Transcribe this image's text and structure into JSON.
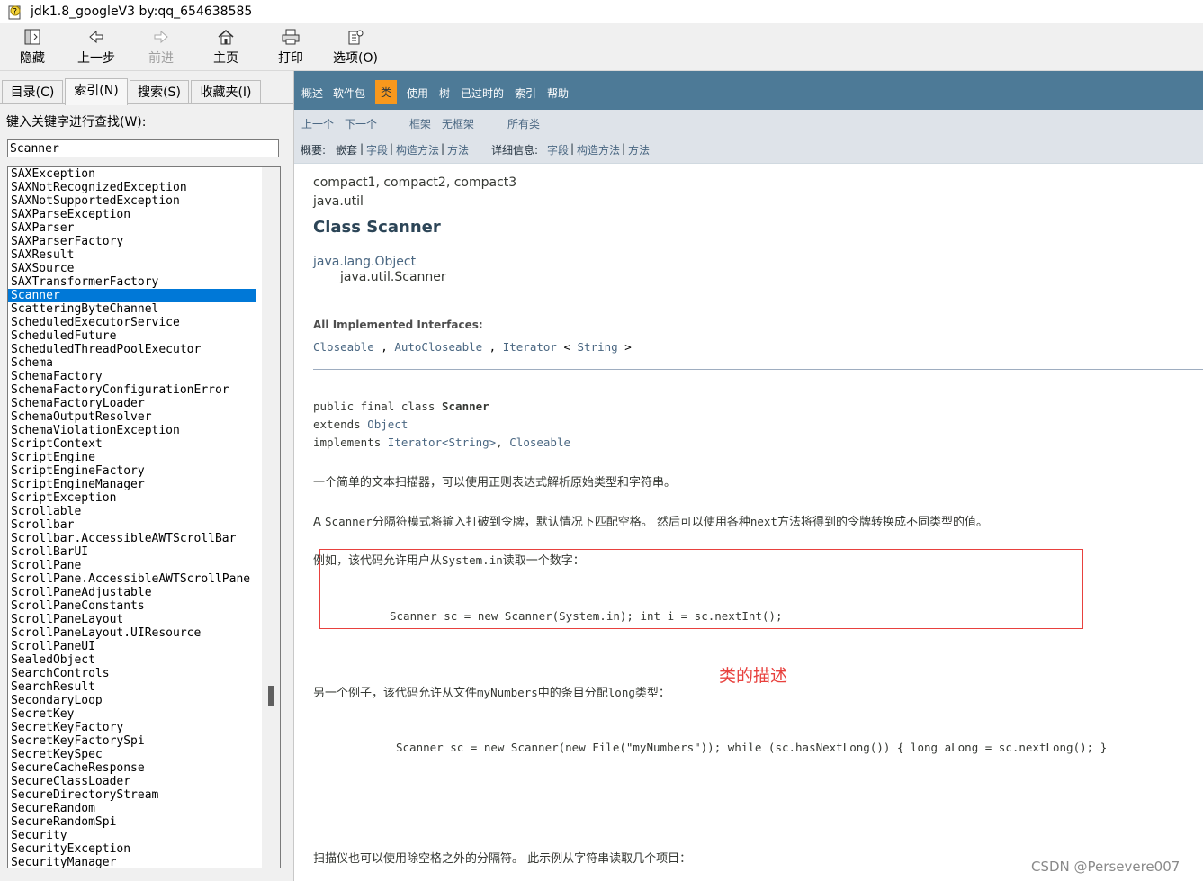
{
  "window": {
    "title": "jdk1.8_googleV3 by:qq_654638585"
  },
  "toolbar": {
    "hide": "隐藏",
    "back": "上一步",
    "forward": "前进",
    "home": "主页",
    "print": "打印",
    "options": "选项(O)"
  },
  "left": {
    "tabs": [
      "目录(C)",
      "索引(N)",
      "搜索(S)",
      "收藏夹(I)"
    ],
    "active_tab": 1,
    "search_label": "键入关键字进行查找(W):",
    "search_value": "Scanner",
    "selected_index": 9,
    "items": [
      "SAXException",
      "SAXNotRecognizedException",
      "SAXNotSupportedException",
      "SAXParseException",
      "SAXParser",
      "SAXParserFactory",
      "SAXResult",
      "SAXSource",
      "SAXTransformerFactory",
      "Scanner",
      "ScatteringByteChannel",
      "ScheduledExecutorService",
      "ScheduledFuture",
      "ScheduledThreadPoolExecutor",
      "Schema",
      "SchemaFactory",
      "SchemaFactoryConfigurationError",
      "SchemaFactoryLoader",
      "SchemaOutputResolver",
      "SchemaViolationException",
      "ScriptContext",
      "ScriptEngine",
      "ScriptEngineFactory",
      "ScriptEngineManager",
      "ScriptException",
      "Scrollable",
      "Scrollbar",
      "Scrollbar.AccessibleAWTScrollBar",
      "ScrollBarUI",
      "ScrollPane",
      "ScrollPane.AccessibleAWTScrollPane",
      "ScrollPaneAdjustable",
      "ScrollPaneConstants",
      "ScrollPaneLayout",
      "ScrollPaneLayout.UIResource",
      "ScrollPaneUI",
      "SealedObject",
      "SearchControls",
      "SearchResult",
      "SecondaryLoop",
      "SecretKey",
      "SecretKeyFactory",
      "SecretKeyFactorySpi",
      "SecretKeySpec",
      "SecureCacheResponse",
      "SecureClassLoader",
      "SecureDirectoryStream",
      "SecureRandom",
      "SecureRandomSpi",
      "Security",
      "SecurityException",
      "SecurityManager"
    ]
  },
  "nav": {
    "items": [
      "概述",
      "软件包",
      "类",
      "使用",
      "树",
      "已过时的",
      "索引",
      "帮助"
    ],
    "prev": "上一个",
    "next": "下一个",
    "frames": "框架",
    "noframes": "无框架",
    "allclasses": "所有类",
    "summary_label": "概要:",
    "summary_nested": "嵌套",
    "summary_field": "字段",
    "summary_ctor": "构造方法",
    "summary_method": "方法",
    "detail_label": "详细信息:",
    "detail_field": "字段",
    "detail_ctor": "构造方法",
    "detail_method": "方法"
  },
  "doc": {
    "profiles": "compact1, compact2, compact3",
    "package": "java.util",
    "class_title": "Class Scanner",
    "inherit_parent": "java.lang.Object",
    "inherit_child": "java.util.Scanner",
    "interfaces_label": "All Implemented Interfaces:",
    "if1": "Closeable",
    "if2": "AutoCloseable",
    "if3": "Iterator",
    "if3_type": "String",
    "sig_kw1": "public final class ",
    "sig_name": "Scanner",
    "sig_kw2": "extends ",
    "sig_extends": "Object",
    "sig_kw3": "implements ",
    "sig_impl1": "Iterator<String>",
    "sig_impl2": "Closeable",
    "desc1": "一个简单的文本扫描器，可以使用正则表达式解析原始类型和字符串。",
    "desc2_a": "A ",
    "desc2_code1": "Scanner",
    "desc2_b": "分隔符模式将输入打破到令牌，默认情况下匹配空格。 然后可以使用各种",
    "desc2_code2": "next",
    "desc2_c": "方法将得到的令牌转换成不同类型的值。",
    "ex1_a": "例如，该代码允许用户从",
    "ex1_code": "System.in",
    "ex1_b": "读取一个数字：",
    "code1_l1": "Scanner sc = new Scanner(System.in);",
    "code1_l2": " int i = sc.nextInt();",
    "ex2_a": "另一个例子，该代码允许从文件",
    "ex2_code1": "myNumbers",
    "ex2_b": "中的条目分配",
    "ex2_code2": "long",
    "ex2_c": "类型：",
    "code2_l1": "Scanner sc = new Scanner(new File(\"myNumbers\"));",
    "code2_l2": " while (sc.hasNextLong()) {",
    "code2_l3": "     long aLong = sc.nextLong();",
    "code2_l4": " }",
    "ex3": "扫描仪也可以使用除空格之外的分隔符。 此示例从字符串读取几个项目："
  },
  "annotation": {
    "label": "类的描述"
  },
  "watermark": "CSDN @Persevere007",
  "colors": {
    "nav_bg": "#4d7a97",
    "nav_active": "#f8981d",
    "subnav_bg": "#dee3e9",
    "link": "#4a6782",
    "select": "#0078d7",
    "annotation": "#e8413e"
  }
}
